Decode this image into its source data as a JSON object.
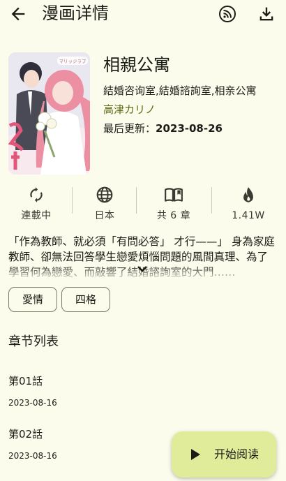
{
  "appbar": {
    "title": "漫画详情",
    "back_icon": "arrow-back-icon",
    "actions": [
      "rss-feed-icon",
      "download-icon"
    ]
  },
  "comic": {
    "name": "相親公寓",
    "alias": "結婚咨询室,結婚諮詢室,相亲公寓",
    "author": "高津カリノ",
    "updated_label": "最后更新：",
    "updated_date": "2023-08-26",
    "cover_text": "マリッジラブ"
  },
  "stats": [
    {
      "icon": "sync-icon",
      "label": "連載中"
    },
    {
      "icon": "globe-icon",
      "label": "日本"
    },
    {
      "icon": "book-open-icon",
      "label": "共 6 章"
    },
    {
      "icon": "fire-icon",
      "label": "1.41W"
    }
  ],
  "description": "「作為教師、就必須「有問必答」 才行——」 身為家庭教師、卻無法回答學生戀愛煩惱問題的風間真理、為了學習何為戀愛、而敲響了結婚諮詢室的大門……",
  "tags": [
    "愛情",
    "四格"
  ],
  "chapter_section_title": "章节列表",
  "chapters": [
    {
      "title": "第01話",
      "date": "2023-08-16"
    },
    {
      "title": "第02話",
      "date": "2023-08-16"
    }
  ],
  "fab": {
    "label": "开始阅读",
    "icon": "play-icon"
  },
  "colors": {
    "background": "#fbfcec",
    "accent": "#5b6b12",
    "fab": "#e0ec9a"
  }
}
